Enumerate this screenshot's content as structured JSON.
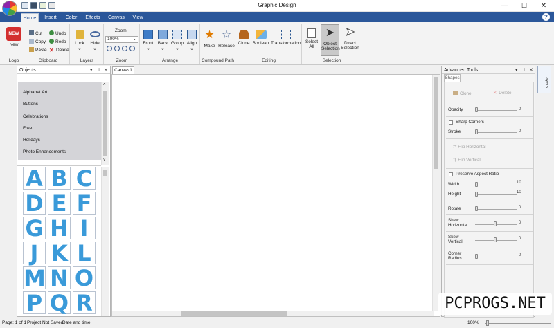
{
  "window": {
    "title": "Graphic Design",
    "minimize": "—",
    "maximize": "☐",
    "close": "✕"
  },
  "colors": {
    "tabbar": "#2b579a",
    "letter": "#3a9ad9"
  },
  "ribbon": {
    "tabs": [
      "Home",
      "Insert",
      "Color",
      "Effects",
      "Canvas",
      "View"
    ],
    "active_tab": "Home",
    "help": "?",
    "groups": {
      "logo": {
        "label": "Logo",
        "new_badge": "NEW",
        "new_label": "New"
      },
      "clipboard": {
        "label": "Clipboard",
        "cut": "Cut",
        "copy": "Copy",
        "paste": "Paste",
        "undo": "Undo",
        "redo": "Redo",
        "delete": "Delete"
      },
      "layers": {
        "label": "Layers",
        "lock": "Lock",
        "hide": "Hide"
      },
      "zoom": {
        "label": "Zoom",
        "title": "Zoom",
        "value": "100%"
      },
      "arrange": {
        "label": "Arrange",
        "front": "Front",
        "back": "Back",
        "group": "Group",
        "align": "Align"
      },
      "compound": {
        "label": "Compound Path",
        "make": "Make",
        "release": "Release"
      },
      "editing": {
        "label": "Editing",
        "clone": "Clone",
        "boolean": "Boolean",
        "transformation": "Transformation"
      },
      "selection": {
        "label": "Selection",
        "select_all": "Select\nAll",
        "object_selection": "Object\nSelection",
        "direct_selection": "Direct\nSelection"
      }
    }
  },
  "objects_panel": {
    "title": "Objects",
    "categories": [
      "Alphabet Art",
      "Buttons",
      "Celebrations",
      "Free",
      "Holidays",
      "Photo Enhancements"
    ],
    "letters": [
      "A",
      "B",
      "C",
      "D",
      "E",
      "F",
      "G",
      "H",
      "I",
      "J",
      "K",
      "L",
      "M",
      "N",
      "O",
      "P",
      "Q",
      "R"
    ]
  },
  "canvas": {
    "tab": "Canvas1"
  },
  "advanced_tools": {
    "title": "Advanced Tools",
    "tab": "Shapes",
    "clone": "Clone",
    "delete": "Delete",
    "opacity": {
      "label": "Opacity",
      "value": "0"
    },
    "sharp_corners": "Sharp Corners",
    "stroke": {
      "label": "Stroke",
      "value": "0"
    },
    "flip_horizontal": "Flip Horizontal",
    "flip_vertical": "Flip Vertical",
    "preserve_aspect": "Preserve Aspect Ratio",
    "width": {
      "label": "Width",
      "value": "10"
    },
    "height": {
      "label": "Height",
      "value": "10"
    },
    "rotate": {
      "label": "Rotate",
      "value": "0"
    },
    "skew_h": {
      "label1": "Skew",
      "label2": "Horizontal",
      "value": "0"
    },
    "skew_v": {
      "label1": "Skew",
      "label2": "Vertical",
      "value": "0"
    },
    "corner": {
      "label1": "Corner",
      "label2": "Radius",
      "value": "0"
    }
  },
  "layers_tab": "Layers",
  "status": {
    "page": "Page: 1 of 1",
    "project": "Project Not Saved",
    "datetime": "Date and time",
    "zoom": "100%"
  },
  "watermark": "PCPROGS.NET"
}
